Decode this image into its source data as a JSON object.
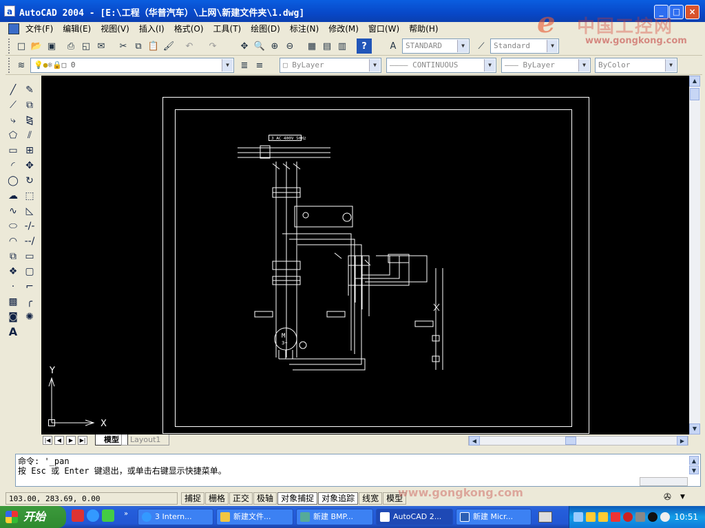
{
  "window": {
    "title": "AutoCAD 2004 - [E:\\工程（华普汽车）\\上网\\新建文件夹\\1.dwg]",
    "app_icon": "a"
  },
  "watermark": {
    "logo": "e",
    "cn": "中国工控网",
    "url": "www.gongkong.com",
    "status_url": "www.gongkong.com"
  },
  "menubar": {
    "items": [
      "文件(F)",
      "编辑(E)",
      "视图(V)",
      "插入(I)",
      "格式(O)",
      "工具(T)",
      "绘图(D)",
      "标注(N)",
      "修改(M)",
      "窗口(W)",
      "帮助(H)"
    ]
  },
  "toolbar": {
    "text_style": "STANDARD",
    "dim_style": "Standard",
    "layer": "0",
    "color": "ByLayer",
    "linetype": "CONTINUOUS",
    "lineweight": "ByLayer",
    "plotstyle": "ByColor"
  },
  "canvas": {
    "ucs_y": "Y",
    "ucs_x": "X",
    "drawing": {
      "header": "3 AC 400V 50Hz",
      "motor_label": "M",
      "motor_sub": "3~"
    }
  },
  "tabs": {
    "model": "模型",
    "layout": "Layout1"
  },
  "command": {
    "line1": "命令: '_pan",
    "line2": "按 Esc 或 Enter 键退出，或单击右键显示快捷菜单。"
  },
  "status": {
    "coords": "103.00, 283.69, 0.00",
    "toggles": [
      "捕捉",
      "栅格",
      "正交",
      "极轴",
      "对象捕捉",
      "对象追踪",
      "线宽",
      "模型"
    ]
  },
  "taskbar": {
    "start": "开始",
    "buttons": [
      "3 Intern...",
      "新建文件...",
      "新建 BMP...",
      "AutoCAD 2...",
      "新建 Micr..."
    ],
    "clock": "10:51"
  }
}
